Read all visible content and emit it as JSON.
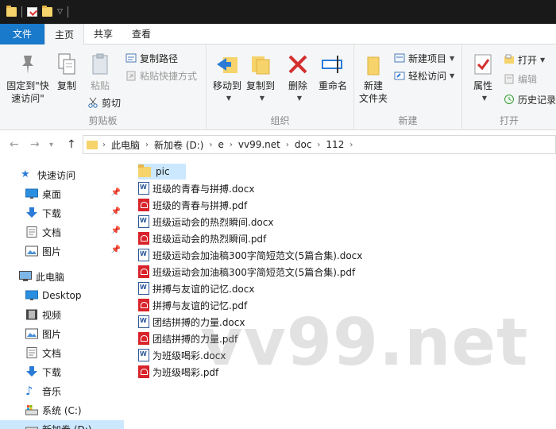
{
  "ribbon_tabs": [
    {
      "label": "文件"
    },
    {
      "label": "主页"
    },
    {
      "label": "共享"
    },
    {
      "label": "查看"
    }
  ],
  "ribbon": {
    "clipboard": {
      "label": "剪贴板",
      "pin_label": "固定到\"快\n速访问\"",
      "copy_label": "复制",
      "paste_label": "粘贴",
      "copy_path_label": "复制路径",
      "paste_shortcut_label": "粘贴快捷方式",
      "cut_label": "剪切"
    },
    "organize": {
      "label": "组织",
      "move_to_label": "移动到",
      "copy_to_label": "复制到",
      "delete_label": "删除",
      "rename_label": "重命名"
    },
    "new": {
      "label": "新建",
      "new_folder_label": "新建\n文件夹",
      "new_item_label": "新建项目",
      "easy_access_label": "轻松访问"
    },
    "open": {
      "label": "打开",
      "properties_label": "属性",
      "open_label": "打开",
      "edit_label": "编辑",
      "history_label": "历史记录"
    }
  },
  "address": {
    "crumbs": [
      "此电脑",
      "新加卷 (D:)",
      "e",
      "vv99.net",
      "doc",
      "112"
    ]
  },
  "nav": {
    "quick_access": "快速访问",
    "quick_items": [
      "桌面",
      "下载",
      "文档",
      "图片"
    ],
    "this_pc": "此电脑",
    "pc_items": [
      "Desktop",
      "视频",
      "图片",
      "文档",
      "下载",
      "音乐",
      "系统 (C:)",
      "新加卷 (D:)"
    ]
  },
  "files": [
    {
      "name": "pic",
      "type": "folder"
    },
    {
      "name": "班级的青春与拼搏.docx",
      "type": "docx"
    },
    {
      "name": "班级的青春与拼搏.pdf",
      "type": "pdf"
    },
    {
      "name": "班级运动会的热烈瞬间.docx",
      "type": "docx"
    },
    {
      "name": "班级运动会的热烈瞬间.pdf",
      "type": "pdf"
    },
    {
      "name": "班级运动会加油稿300字简短范文(5篇合集).docx",
      "type": "docx"
    },
    {
      "name": "班级运动会加油稿300字简短范文(5篇合集).pdf",
      "type": "pdf"
    },
    {
      "name": "拼搏与友谊的记忆.docx",
      "type": "docx"
    },
    {
      "name": "拼搏与友谊的记忆.pdf",
      "type": "pdf"
    },
    {
      "name": "团结拼搏的力量.docx",
      "type": "docx"
    },
    {
      "name": "团结拼搏的力量.pdf",
      "type": "pdf"
    },
    {
      "name": "为班级喝彩.docx",
      "type": "docx"
    },
    {
      "name": "为班级喝彩.pdf",
      "type": "pdf"
    }
  ],
  "watermark": "vv99.net",
  "colors": {
    "file_tab": "#1979ca",
    "selection": "#cce8ff",
    "folder": "#f6d36b",
    "pdf": "#d8232a",
    "word": "#2b5797"
  }
}
